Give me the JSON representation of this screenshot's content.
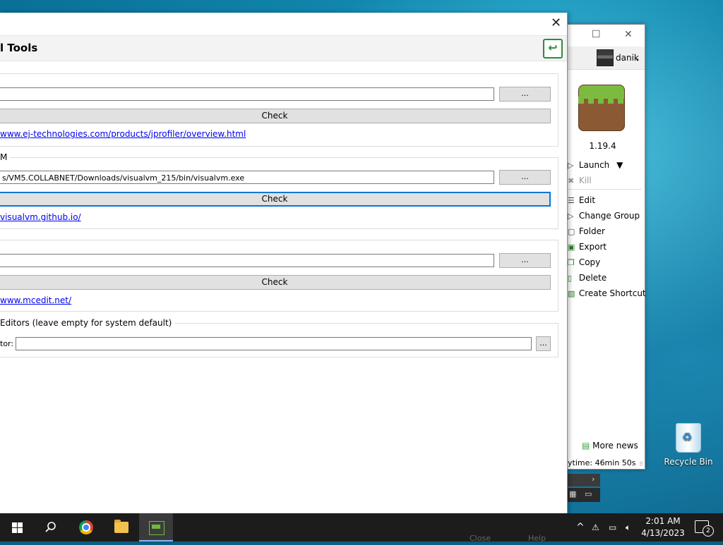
{
  "dialog": {
    "title": "l Tools",
    "close_glyph": "✕",
    "back_glyph": "↩",
    "groups": [
      {
        "label": "",
        "path": "",
        "browse_label": "...",
        "check_label": "Check",
        "link": "www.ej-technologies.com/products/jprofiler/overview.html"
      },
      {
        "label": "M",
        "path": "s/VM5.COLLABNET/Downloads/visualvm_215/bin/visualvm.exe",
        "browse_label": "...",
        "check_label": "Check",
        "link": "visualvm.github.io/"
      },
      {
        "label": "",
        "path": "",
        "browse_label": "...",
        "check_label": "Check",
        "link": "www.mcedit.net/"
      }
    ],
    "editors_group": {
      "label": "Editors (leave empty for system default)",
      "field_label": "tor:",
      "value": "",
      "browse_label": "..."
    },
    "footer_ghost": {
      "close": "Close",
      "help": "Help"
    }
  },
  "launcher": {
    "maximize_glyph": "☐",
    "close_glyph": "✕",
    "username": "danik",
    "caret": "▾",
    "version": "1.19.4",
    "menu": {
      "launch": "Launch",
      "launch_caret": "▼",
      "kill": "Kill",
      "edit": "Edit",
      "change_group": "Change Group",
      "folder": "Folder",
      "export": "Export",
      "copy": "Copy",
      "delete": "Delete",
      "create_shortcut": "Create Shortcut"
    },
    "news": "More news",
    "playtime": "ytime: 46min 50s"
  },
  "desktop": {
    "recycle_bin": "Recycle Bin"
  },
  "taskbar": {
    "time": "2:01 AM",
    "date": "4/13/2023",
    "notifications": "2",
    "tray_up": "^"
  }
}
